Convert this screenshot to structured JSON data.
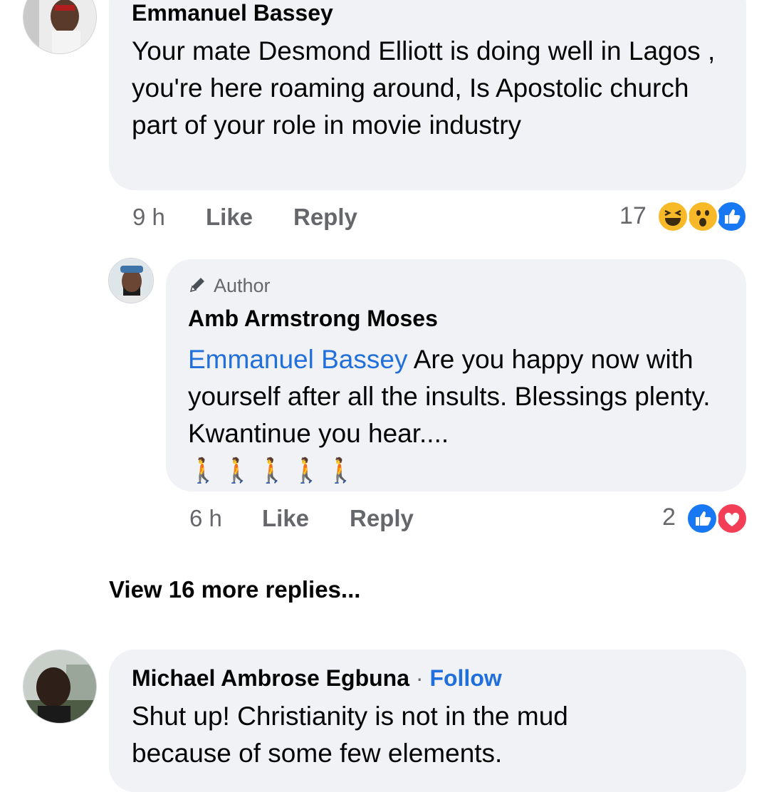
{
  "comments": [
    {
      "author": "Emmanuel Bassey",
      "text": "Your mate Desmond Elliott is doing well in Lagos , you're here roaming around, Is Apostolic church part of your role in movie industry",
      "time": "9 h",
      "like_label": "Like",
      "reply_label": "Reply",
      "reaction_count": "17",
      "reactions": [
        "laugh-emoji-icon",
        "wow-emoji-icon",
        "like-thumb-icon"
      ]
    },
    {
      "author_badge": "Author",
      "author": "Amb Armstrong Moses",
      "mention": "Emmanuel Bassey",
      "text": "Are you happy now with yourself after all the insults. Blessings plenty. Kwantinue you hear....",
      "emoji_line": "🚶🚶🚶🚶🚶",
      "time": "6 h",
      "like_label": "Like",
      "reply_label": "Reply",
      "reaction_count": "2",
      "reactions": [
        "like-thumb-icon",
        "love-heart-icon"
      ]
    },
    {
      "author": "Michael Ambrose Egbuna",
      "follow_label": "Follow",
      "separator": "·",
      "text": "Shut up! Christianity is not in the mud because of some few elements."
    }
  ],
  "view_more_label": "View 16 more replies...",
  "colors": {
    "bubble": "#f0f2f5",
    "link": "#216fdb",
    "meta": "#65676b",
    "like_blue": "#1877f2",
    "love_red": "#f33e58",
    "emoji_yellow": "#f7b928"
  }
}
